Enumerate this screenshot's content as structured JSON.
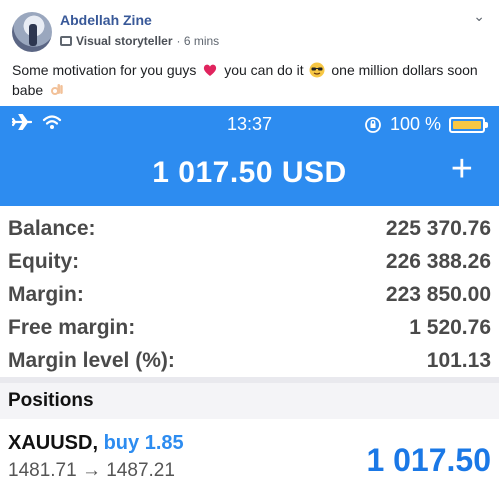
{
  "post": {
    "author": "Abdellah Zine",
    "role": "Visual storyteller",
    "time": "· 6 mins",
    "text_parts": [
      "Some motivation for you guys",
      "you can do it",
      "one million dollars soon babe"
    ],
    "emojis": [
      "heart-emoji",
      "sunglasses-emoji",
      "ok-hand-emoji"
    ],
    "colors": {
      "author": "#385898",
      "text": "#1c1e21"
    }
  },
  "phone": {
    "status": {
      "time": "13:37",
      "battery_text": "100 %"
    },
    "header": {
      "equity": "1 017.50 USD",
      "plus": "+"
    },
    "accent": "#2d8cf0",
    "rows": [
      {
        "label": "Balance:",
        "value": "225 370.76"
      },
      {
        "label": "Equity:",
        "value": "226 388.26"
      },
      {
        "label": "Margin:",
        "value": "223 850.00"
      },
      {
        "label": "Free margin:",
        "value": "1 520.76"
      },
      {
        "label": "Margin level (%):",
        "value": "101.13"
      }
    ],
    "positions_title": "Positions",
    "position": {
      "symbol": "XAUUSD,",
      "side": "buy 1.85",
      "prices": "1481.71 → 1487.21",
      "profit": "1 017.50"
    }
  }
}
